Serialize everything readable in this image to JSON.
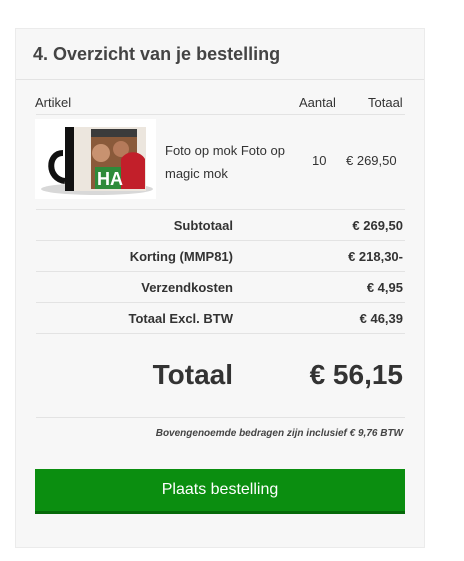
{
  "section": {
    "title": "4. Overzicht van je bestelling"
  },
  "table": {
    "headers": {
      "article": "Artikel",
      "quantity": "Aantal",
      "total": "Totaal"
    },
    "items": [
      {
        "name": "Foto op mok Foto op magic mok",
        "quantity": "10",
        "total": "€ 269,50",
        "image_text": "HA"
      }
    ]
  },
  "summary": {
    "rows": [
      {
        "label": "Subtotaal",
        "value": "€ 269,50"
      },
      {
        "label": "Korting (MMP81)",
        "value": "€ 218,30-"
      },
      {
        "label": "Verzendkosten",
        "value": "€ 4,95"
      },
      {
        "label": "Totaal Excl. BTW",
        "value": "€ 46,39"
      }
    ],
    "grand_total_label": "Totaal",
    "grand_total_value": "€ 56,15",
    "vat_note": "Bovengenoemde bedragen zijn inclusief € 9,76 BTW"
  },
  "actions": {
    "place_order_label": "Plaats bestelling"
  },
  "colors": {
    "button": "#0b8e10",
    "panel_bg": "#f7f7f7"
  }
}
